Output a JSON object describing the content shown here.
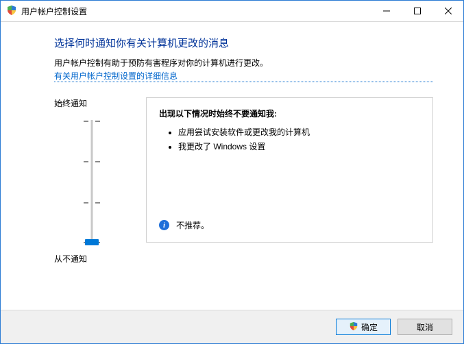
{
  "window": {
    "title": "用户帐户控制设置"
  },
  "header": {
    "heading": "选择何时通知你有关计算机更改的消息",
    "description": "用户帐户控制有助于预防有害程序对你的计算机进行更改。",
    "link_text": "有关用户帐户控制设置的详细信息"
  },
  "slider": {
    "top_label": "始终通知",
    "bottom_label": "从不通知"
  },
  "panel": {
    "title": "出现以下情况时始终不要通知我:",
    "bullets": [
      "应用尝试安装软件或更改我的计算机",
      "我更改了 Windows 设置"
    ],
    "footer_text": "不推荐。"
  },
  "buttons": {
    "ok": "确定",
    "cancel": "取消"
  }
}
